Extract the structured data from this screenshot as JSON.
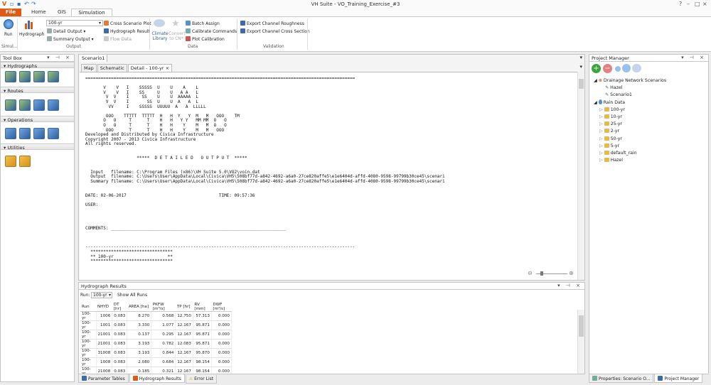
{
  "app": {
    "title": "VH Suite - VO_Training_Exercise_#3"
  },
  "menu": {
    "file": "File",
    "tabs": [
      "Home",
      "GIS",
      "Simulation"
    ]
  },
  "ribbon": {
    "run": "Run",
    "hydrograph": "Hydrograph",
    "storm_select": "100-yr",
    "detail_output": "Detail Output",
    "summary_output": "Summary Output",
    "cross_scenario_plot": "Cross Scenario Plot",
    "hydrograph_result": "Hydrograph Result",
    "flow_data": "Flow Data",
    "climate_library": "Climate Library",
    "convert_to_cn": "Convert to CN*",
    "batch_assign": "Batch Assign",
    "calibrate_commands": "Calibrate Commands",
    "plot_calibration": "Plot Calibration",
    "export_roughness": "Export Channel Roughness",
    "export_cross_section": "Export Channel Cross Section",
    "groups": {
      "simul": "Simul...",
      "output": "Output",
      "data": "Data",
      "validation": "Validation"
    }
  },
  "toolbox": {
    "title": "Tool Box",
    "sections": {
      "hydrographs": "Hydrographs",
      "routes": "Routes",
      "operations": "Operations",
      "utilities": "Utilities"
    }
  },
  "main": {
    "outer_tab": "Scenario1",
    "tabs": [
      "Map",
      "Schematic",
      "Detail - 100-yr"
    ],
    "output_lines": [
      "=========================================================================================================",
      "",
      "       V    V   I    SSSSS  U    U    A    L",
      "       V    V   I    SS     U    U   A A   L",
      "        V  V    I     SS    U    U  AAAAA  L",
      "        V  V    I       SS  U    U  A   A  L",
      "         VV     I    SSSSS  UUUUU  A   A  LLLLL",
      "",
      "        OOO    TTTTT  TTTTT  H   H  Y   Y  M   M   OOO    TM",
      "       O   O     T      T    H   H   Y Y   MM MM  O   O",
      "       O   O     T      T    H   H    Y    M   M  O   O",
      "        OOO      T      T    H   H    Y    M   M   OOO",
      "Developed and Distributed by Civica Infrastructure",
      "Copyright 2007 - 2013 Civica Infrastructure",
      "All rights reserved.",
      "",
      "",
      "                    *****  D E T A I L E D   O U T P U T  *****",
      "",
      "",
      "  Input   filename: C:\\Program Files (x86)\\VH Suite 5.0\\VO2\\voin.dat",
      "  Output  filename: C:\\Users\\User\\AppData\\Local\\Civica\\VH5\\508bf77d-a842-4692-a6a0-27ce820affe5\\e1e6404d-affd-4080-9598-99799b30ce45\\scenari",
      "  Summary filename: C:\\Users\\User\\AppData\\Local\\Civica\\VH5\\508bf77d-a842-4692-a6a0-27ce820affe5\\e1e6404d-affd-4080-9598-99799b30ce45\\scenari",
      "",
      "",
      "DATE: 02-06-2017                                    TIME: 09:57:36",
      "",
      "USER:",
      "",
      "",
      "",
      "",
      "COMMENTS: ____________________________________________________________________",
      "",
      "",
      "",
      "---------------------------------------------------------------------------------------------------------",
      "  ********************************",
      "  ** 100-yr                     **",
      "  ********************************"
    ]
  },
  "results": {
    "title": "Hydrograph Results",
    "run_label": "Run:",
    "run_value": "100-yr",
    "show_all": "Show All Runs",
    "columns": [
      "Run",
      "NHYD",
      "DT [hr]",
      "AREA [ha]",
      "PKFW [m³/s]",
      "TP [hr]",
      "RV [mm]",
      "DWF [m³/s]"
    ],
    "rows": [
      [
        "100-yr",
        "1006",
        "0.083",
        "8.270",
        "0.568",
        "12.750",
        "57.313",
        "0.000"
      ],
      [
        "100-yr",
        "1001",
        "0.083",
        "3.330",
        "1.077",
        "12.167",
        "95.871",
        "0.000"
      ],
      [
        "100-yr",
        "21001",
        "0.083",
        "0.137",
        "0.295",
        "12.167",
        "95.871",
        "0.000"
      ],
      [
        "100-yr",
        "21001",
        "0.083",
        "3.193",
        "0.782",
        "12.083",
        "95.871",
        "0.000"
      ],
      [
        "100-yr",
        "31008",
        "0.083",
        "3.193",
        "0.844",
        "12.167",
        "95.870",
        "0.000"
      ],
      [
        "100-yr",
        "1008",
        "0.083",
        "2.080",
        "0.684",
        "12.167",
        "98.154",
        "0.000"
      ],
      [
        "100-yr",
        "21008",
        "0.083",
        "0.185",
        "0.321",
        "12.167",
        "98.154",
        "0.000"
      ],
      [
        "100-yr",
        "21008",
        "0.083",
        "1.895",
        "0.363",
        "12.083",
        "98.154",
        "0.000"
      ],
      [
        "100-yr",
        "16",
        "0.083",
        "5.088",
        "1.207",
        "12.167",
        "96.730",
        "0.000"
      ]
    ]
  },
  "bottom_tabs": [
    "Parameter Tables",
    "Hydrograph Results",
    "Error List"
  ],
  "project": {
    "title": "Project Manager",
    "scenarios_label": "Drainage Network Scenarios",
    "scenarios": [
      "Hazel",
      "Scenario1"
    ],
    "rain_label": "Rain Data",
    "rain": [
      "100-yr",
      "10-yr",
      "25-yr",
      "2-yr",
      "50-yr",
      "5-yr",
      "default_rain",
      "Hazel"
    ]
  },
  "right_tabs": [
    "Properties: Scenario O...",
    "Project Manager"
  ]
}
